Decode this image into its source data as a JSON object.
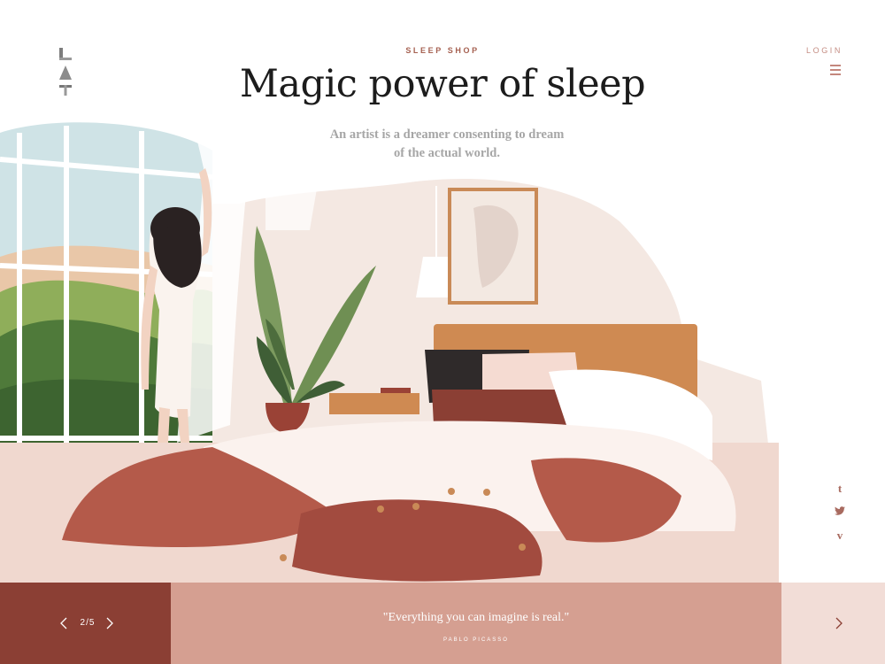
{
  "header": {
    "eyebrow": "SLEEP SHOP",
    "login_label": "LOGIN",
    "title": "Magic power of sleep",
    "subtitle_line1": "An artist is a dreamer consenting to dream",
    "subtitle_line2": "of the actual world."
  },
  "social": [
    {
      "icon": "tumblr-icon",
      "glyph": "t"
    },
    {
      "icon": "twitter-icon",
      "glyph": "🐦"
    },
    {
      "icon": "vimeo-icon",
      "glyph": "v"
    }
  ],
  "footer": {
    "pager": "2/5",
    "quote": "\"Everything you can imagine is real.\"",
    "author": "PABLO PICASSO"
  },
  "colors": {
    "accent_dark": "#8b3f34",
    "accent_mid": "#d59f91",
    "accent_light": "#f2ddd7",
    "bed_red": "#b45a4a",
    "wood": "#cf8a52"
  }
}
